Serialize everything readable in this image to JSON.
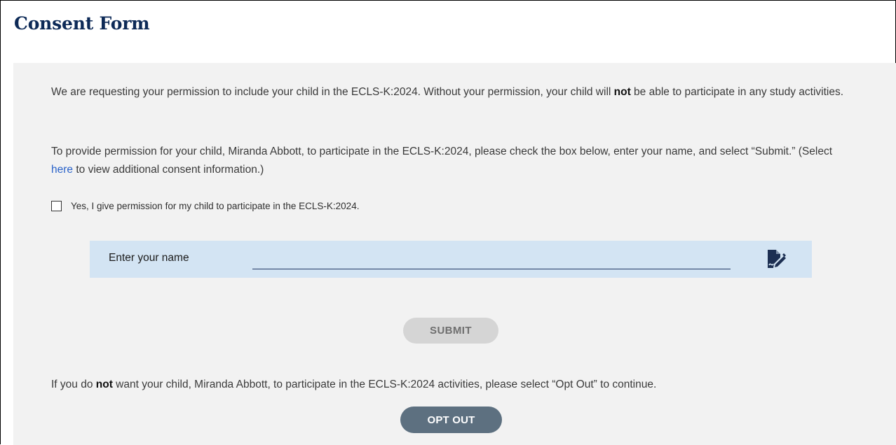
{
  "page": {
    "title": "Consent Form"
  },
  "intro": {
    "line_start": "We are requesting your permission to include your child in the ECLS-K:2024. Without your permission, your child will ",
    "emphasis": "not",
    "line_end": " be able to participate in any study activities."
  },
  "instructions": {
    "text_start": "To provide permission for your child, Miranda Abbott, to participate in the ECLS-K:2024, please check the box below, enter your name, and select “Submit.” (Select ",
    "link_label": "here",
    "text_end": " to view additional consent information.)"
  },
  "consent_checkbox": {
    "label": "Yes, I give permission for my child to participate in the ECLS-K:2024.",
    "checked": false
  },
  "name_field": {
    "label": "Enter your name",
    "value": "",
    "icon": "signature-icon"
  },
  "submit": {
    "label": "SUBMIT"
  },
  "opt_out_text": {
    "start": "If you do ",
    "emphasis": "not",
    "end": " want your child, Miranda Abbott, to participate in the ECLS-K:2024 activities, please select “Opt Out” to continue."
  },
  "opt_out": {
    "label": "OPT OUT"
  },
  "colors": {
    "title": "#0d2a57",
    "panel_bg": "#f2f2f2",
    "name_bar_bg": "#d3e4f3",
    "link": "#2a63c9",
    "submit_bg": "#d5d5d5",
    "opt_out_bg": "#5d7080"
  }
}
